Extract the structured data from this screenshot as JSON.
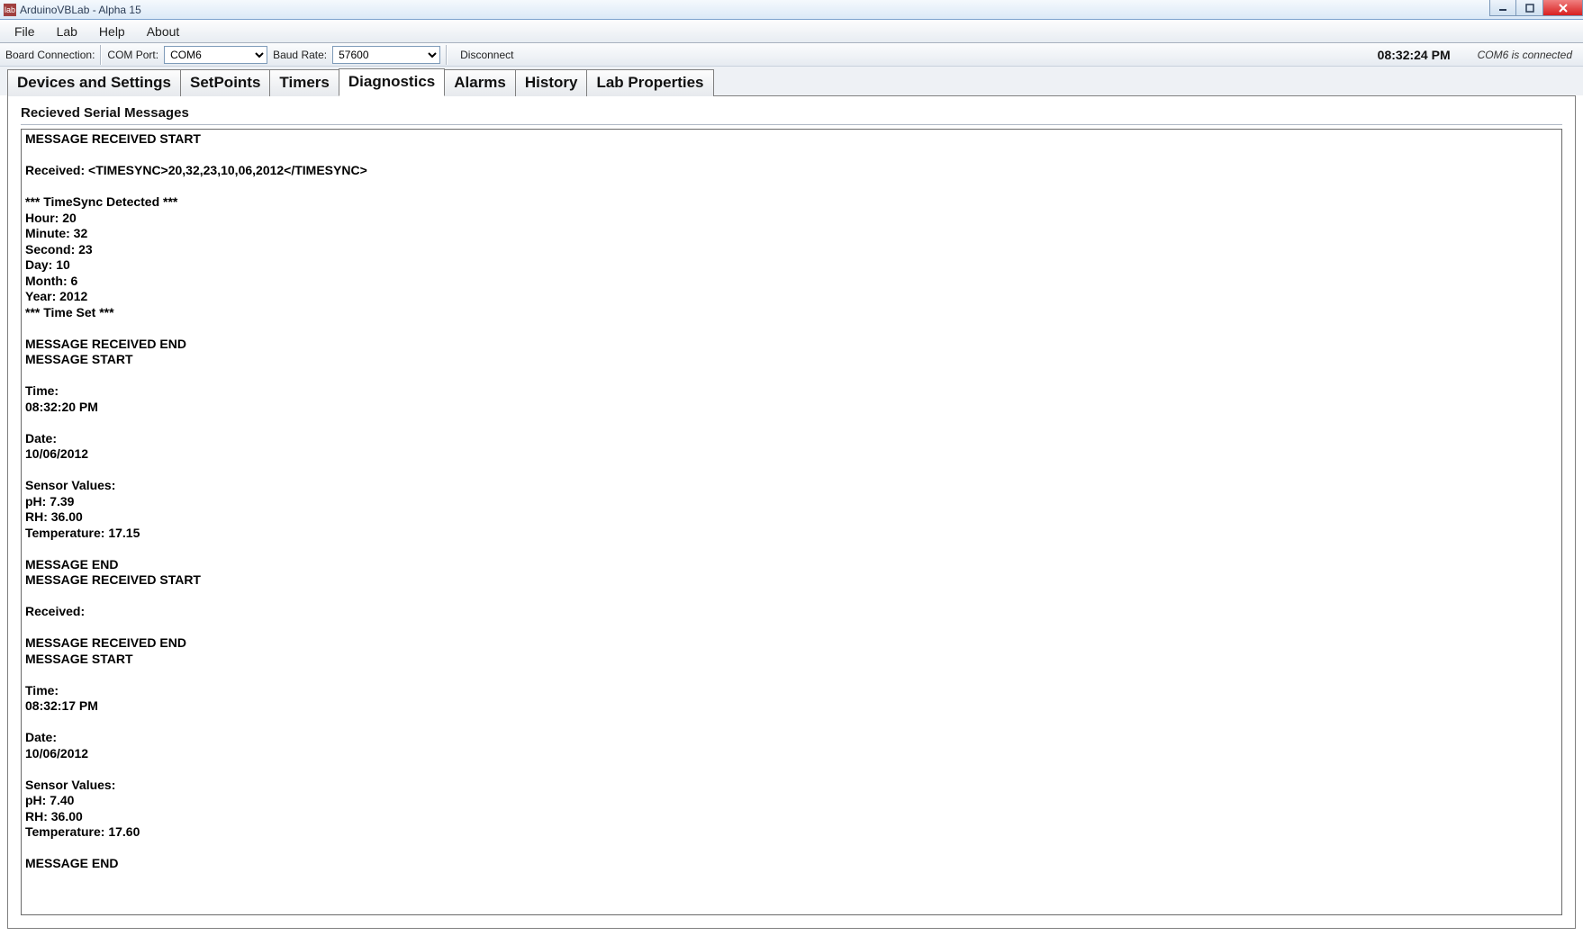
{
  "titlebar": {
    "app_icon_text": "lab",
    "title": "ArduinoVBLab - Alpha 15"
  },
  "menubar": {
    "items": [
      "File",
      "Lab",
      "Help",
      "About"
    ]
  },
  "toolstrip": {
    "board_connection_label": "Board Connection:",
    "com_port_label": "COM Port:",
    "com_port_value": "COM6",
    "baud_rate_label": "Baud Rate:",
    "baud_rate_value": "57600",
    "disconnect_label": "Disconnect",
    "clock": "08:32:24 PM",
    "status": "COM6 is connected"
  },
  "tabs": {
    "items": [
      {
        "label": "Devices and Settings",
        "active": false
      },
      {
        "label": "SetPoints",
        "active": false
      },
      {
        "label": "Timers",
        "active": false
      },
      {
        "label": "Diagnostics",
        "active": true
      },
      {
        "label": "Alarms",
        "active": false
      },
      {
        "label": "History",
        "active": false
      },
      {
        "label": "Lab Properties",
        "active": false
      }
    ]
  },
  "diagnostics": {
    "section_title": "Recieved Serial Messages",
    "serial_log": "MESSAGE RECEIVED START\n\nReceived: <TIMESYNC>20,32,23,10,06,2012</TIMESYNC>\n\n*** TimeSync Detected ***\nHour: 20\nMinute: 32\nSecond: 23\nDay: 10\nMonth: 6\nYear: 2012\n*** Time Set ***\n\nMESSAGE RECEIVED END\nMESSAGE START\n\nTime:\n08:32:20 PM\n\nDate:\n10/06/2012\n\nSensor Values:\npH: 7.39\nRH: 36.00\nTemperature: 17.15\n\nMESSAGE END\nMESSAGE RECEIVED START\n\nReceived:\n\nMESSAGE RECEIVED END\nMESSAGE START\n\nTime:\n08:32:17 PM\n\nDate:\n10/06/2012\n\nSensor Values:\npH: 7.40\nRH: 36.00\nTemperature: 17.60\n\nMESSAGE END"
  }
}
